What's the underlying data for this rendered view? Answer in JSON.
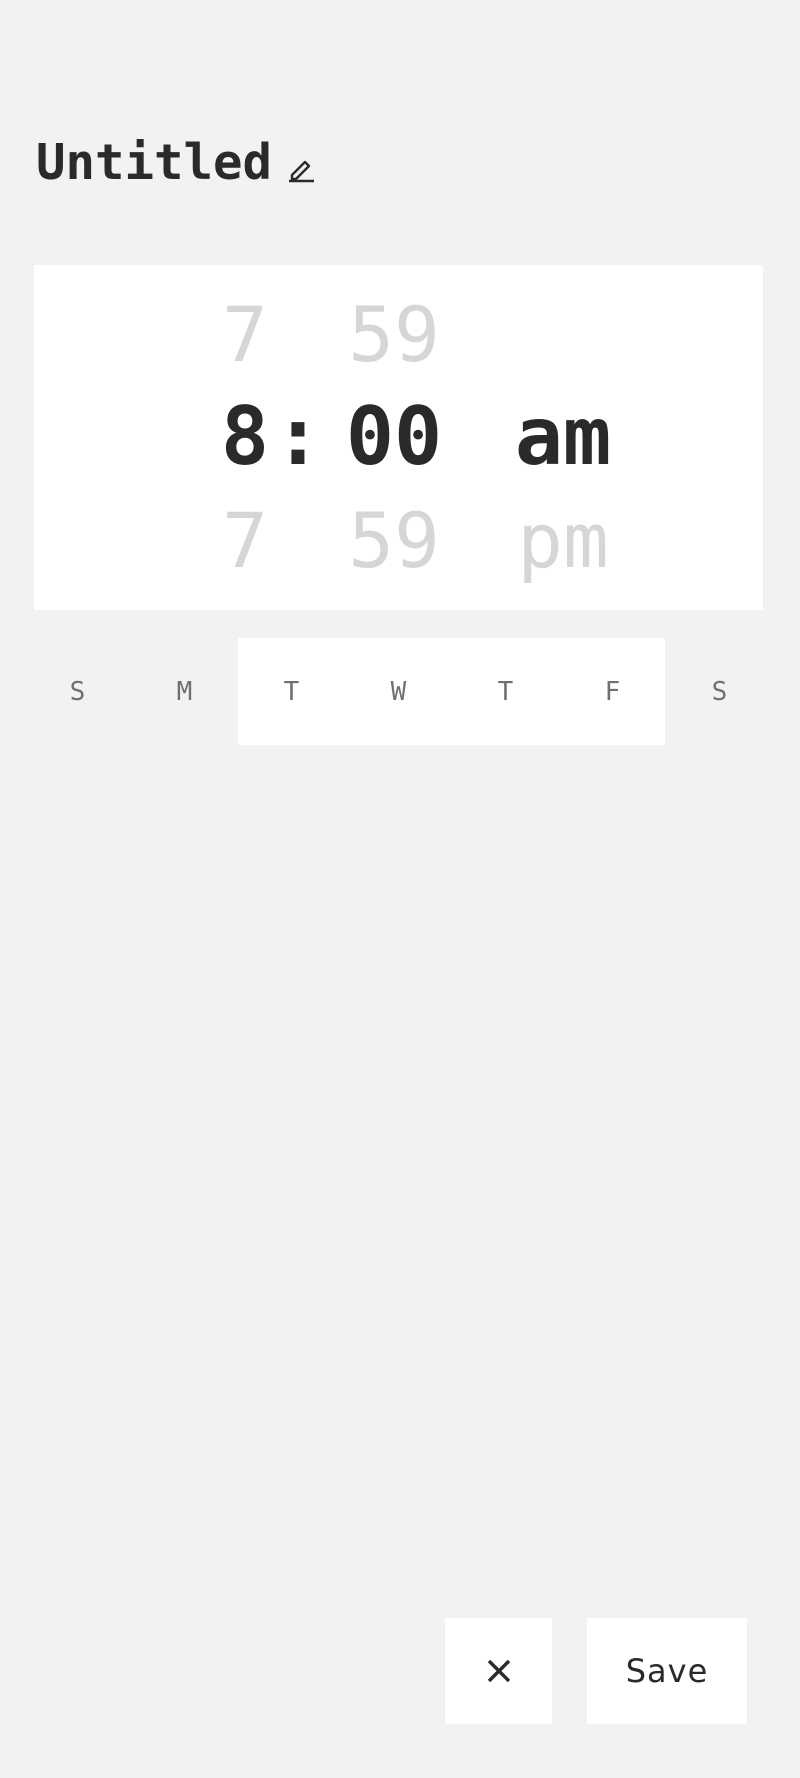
{
  "header": {
    "title": "Untitled",
    "edit_icon": "pencil-icon"
  },
  "time_picker": {
    "hour": {
      "prev": "7",
      "selected": "8",
      "next": "7"
    },
    "separator": ":",
    "minute": {
      "prev": "59",
      "selected": "00",
      "next": "59"
    },
    "period": {
      "prev": "",
      "selected": "am",
      "next": "pm"
    }
  },
  "days": [
    {
      "label": "S",
      "selected": false
    },
    {
      "label": "M",
      "selected": false
    },
    {
      "label": "T",
      "selected": true
    },
    {
      "label": "W",
      "selected": true
    },
    {
      "label": "T",
      "selected": true
    },
    {
      "label": "F",
      "selected": true
    },
    {
      "label": "S",
      "selected": false
    }
  ],
  "actions": {
    "close_icon": "close-icon",
    "save_label": "Save"
  },
  "colors": {
    "background": "#f2f2f2",
    "card": "#ffffff",
    "text_primary": "#2a2a2a",
    "text_dim": "#d6d6d6",
    "day_text": "#707070"
  }
}
